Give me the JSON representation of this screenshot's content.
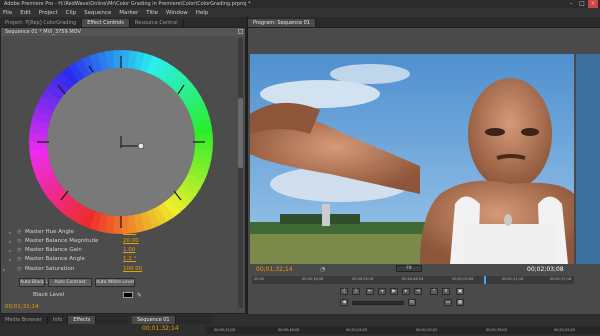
{
  "app": {
    "title": "Adobe Premiere Pro - H:\\RedWave\\Online\\Mr\\Color Grading in Premiere\\Color\\ColorGrading.prproj *",
    "menu": [
      "File",
      "Edit",
      "Project",
      "Clip",
      "Sequence",
      "Marker",
      "Title",
      "Window",
      "Help"
    ]
  },
  "left_panel": {
    "tabs": [
      "Project: F[Rep] ColorGrading",
      "Effect Controls",
      "Resource Central"
    ],
    "active_tab": 1,
    "clip_header": "Sequence 01 * MVI_3759.MOV",
    "params": [
      {
        "label": "Master Hue Angle",
        "value": "0.0 °"
      },
      {
        "label": "Master Balance Magnitude",
        "value": "20.00"
      },
      {
        "label": "Master Balance Gain",
        "value": "1.00"
      },
      {
        "label": "Master Balance Angle",
        "value": "1.2 °"
      },
      {
        "label": "Master Saturation",
        "value": "100.00"
      }
    ],
    "buttons": [
      "Auto Black Level",
      "Auto Contrast",
      "Auto White Level"
    ],
    "black_level_label": "Black Level",
    "timecode": "00;01;32;14"
  },
  "program": {
    "tab": "Program: Sequence 01",
    "timecode_left": "00;01;32;14",
    "fit": "Fit",
    "timecode_right": "00;02;03;08",
    "ruler": [
      "00;00",
      "00;00;16;08",
      "00;00;32;16",
      "00;00;48;24",
      "00;01;05;06",
      "00;01;21;16",
      "00;01;37;18"
    ],
    "colors": {
      "sky": "#6fa8d8",
      "timecode": "#e8a100"
    }
  },
  "bottom": {
    "tabs": [
      "Media Browser",
      "Info",
      "Effects"
    ],
    "active_tab": 2,
    "seq_tab": "Sequence 01",
    "timecode": "00;01;32;14",
    "ruler": [
      "00;00;32;00",
      "00;00;48;00",
      "00;01;04;02",
      "00;01;20;02",
      "00;01;36;02",
      "00;01;52;02"
    ]
  }
}
